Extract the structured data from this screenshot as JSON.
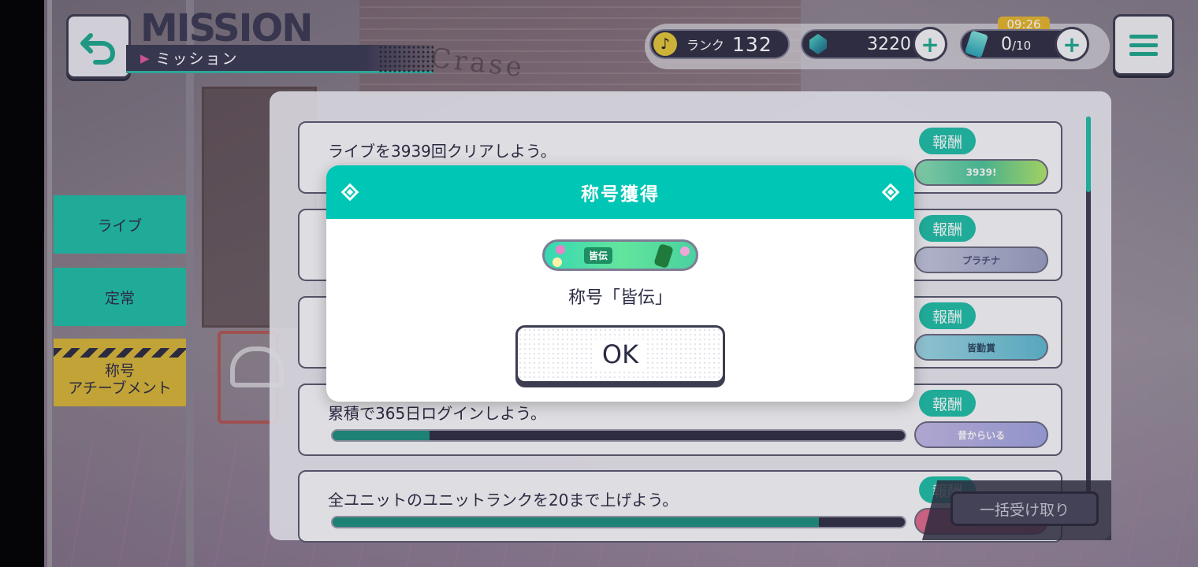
{
  "header": {
    "title_en": "MISSION",
    "title_jp": "ミッション"
  },
  "status": {
    "rank_label": "ランク",
    "rank_value": "132",
    "gems": "3220",
    "timer": "09:26",
    "energy_current": "0",
    "energy_max": "/10"
  },
  "tabs": [
    {
      "label": "ライブ"
    },
    {
      "label": "定常"
    },
    {
      "label": "称号\nアチーブメント"
    }
  ],
  "missions": [
    {
      "text": "ライブを3939回クリアしよう。",
      "reward_label": "報酬",
      "plate_text": "3939!",
      "progress": null
    },
    {
      "text": "",
      "reward_label": "報酬",
      "plate_text": "プラチナ",
      "progress": null
    },
    {
      "text": "",
      "reward_label": "報酬",
      "plate_text": "皆勤賞",
      "progress": null
    },
    {
      "text": "累積で365日ログインしよう。",
      "reward_label": "報酬",
      "plate_text": "昔からいる",
      "progress": 0.17
    },
    {
      "text": "全ユニットのユニットランクを20まで上げよう。",
      "reward_label": "報酬",
      "plate_text": "",
      "progress": 0.85
    }
  ],
  "bulk_button": "一括受け取り",
  "dialog": {
    "title": "称号獲得",
    "plate_label": "皆伝",
    "message": "称号「皆伝」",
    "ok": "OK"
  },
  "colors": {
    "accent": "#00c6b5",
    "dark": "#2f2f45",
    "tab_gold": "#d6b53a"
  }
}
